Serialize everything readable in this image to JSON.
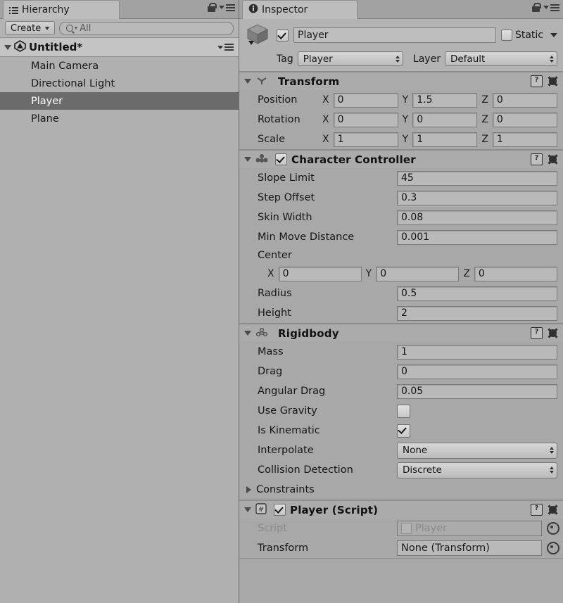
{
  "hierarchy": {
    "tab_label": "Hierarchy",
    "tab_icon": "list-icon",
    "lock_icon": "lock-icon",
    "menu_icon": "hamburger-menu-icon",
    "create_button": "Create",
    "search": {
      "value": "",
      "placeholder": "All",
      "icon": "search-icon"
    },
    "scene": {
      "name": "Untitled*",
      "icon": "unity-logo-icon",
      "expanded": true
    },
    "objects": [
      {
        "label": "Main Camera",
        "selected": false
      },
      {
        "label": "Directional Light",
        "selected": false
      },
      {
        "label": "Player",
        "selected": true
      },
      {
        "label": "Plane",
        "selected": false
      }
    ]
  },
  "inspector": {
    "tab_label": "Inspector",
    "tab_icon": "info-icon",
    "lock_icon": "lock-icon",
    "menu_icon": "hamburger-menu-icon",
    "header": {
      "object_icon": "cube-icon",
      "enabled": true,
      "name": "Player",
      "static_label": "Static",
      "static_checked": false,
      "tag_label": "Tag",
      "tag_value": "Player",
      "layer_label": "Layer",
      "layer_value": "Default"
    },
    "components": [
      {
        "title": "Transform",
        "icon": "transform-gizmo-icon",
        "expanded": true,
        "has_checkbox": false,
        "help_icon": "help-icon",
        "gear_icon": "gear-icon",
        "vectors": [
          {
            "label": "Position",
            "x": "0",
            "y": "1.5",
            "z": "0"
          },
          {
            "label": "Rotation",
            "x": "0",
            "y": "0",
            "z": "0"
          },
          {
            "label": "Scale",
            "x": "1",
            "y": "1",
            "z": "1"
          }
        ]
      },
      {
        "title": "Character Controller",
        "icon": "character-controller-icon",
        "expanded": true,
        "has_checkbox": true,
        "enabled": true,
        "help_icon": "help-icon",
        "gear_icon": "gear-icon",
        "fields": [
          {
            "label": "Slope Limit",
            "value": "45"
          },
          {
            "label": "Step Offset",
            "value": "0.3"
          },
          {
            "label": "Skin Width",
            "value": "0.08"
          },
          {
            "label": "Min Move Distance",
            "value": "0.001"
          }
        ],
        "center": {
          "label": "Center",
          "x": "0",
          "y": "0",
          "z": "0"
        },
        "fields2": [
          {
            "label": "Radius",
            "value": "0.5"
          },
          {
            "label": "Height",
            "value": "2"
          }
        ]
      },
      {
        "title": "Rigidbody",
        "icon": "rigidbody-icon",
        "expanded": true,
        "has_checkbox": false,
        "help_icon": "help-icon",
        "gear_icon": "gear-icon",
        "fields": [
          {
            "label": "Mass",
            "value": "1"
          },
          {
            "label": "Drag",
            "value": "0"
          },
          {
            "label": "Angular Drag",
            "value": "0.05"
          }
        ],
        "toggles": [
          {
            "label": "Use Gravity",
            "checked": false
          },
          {
            "label": "Is Kinematic",
            "checked": true
          }
        ],
        "dropdowns": [
          {
            "label": "Interpolate",
            "value": "None"
          },
          {
            "label": "Collision Detection",
            "value": "Discrete"
          }
        ],
        "foldout": {
          "label": "Constraints",
          "expanded": false
        }
      },
      {
        "title": "Player (Script)",
        "icon": "script-icon",
        "expanded": true,
        "has_checkbox": true,
        "enabled": true,
        "help_icon": "help-icon",
        "gear_icon": "gear-icon",
        "object_fields": [
          {
            "label": "Script",
            "value": "Player",
            "disabled": true,
            "picker_icon": "object-picker-icon"
          },
          {
            "label": "Transform",
            "value": "None (Transform)",
            "disabled": false,
            "picker_icon": "object-picker-icon"
          }
        ]
      }
    ]
  }
}
